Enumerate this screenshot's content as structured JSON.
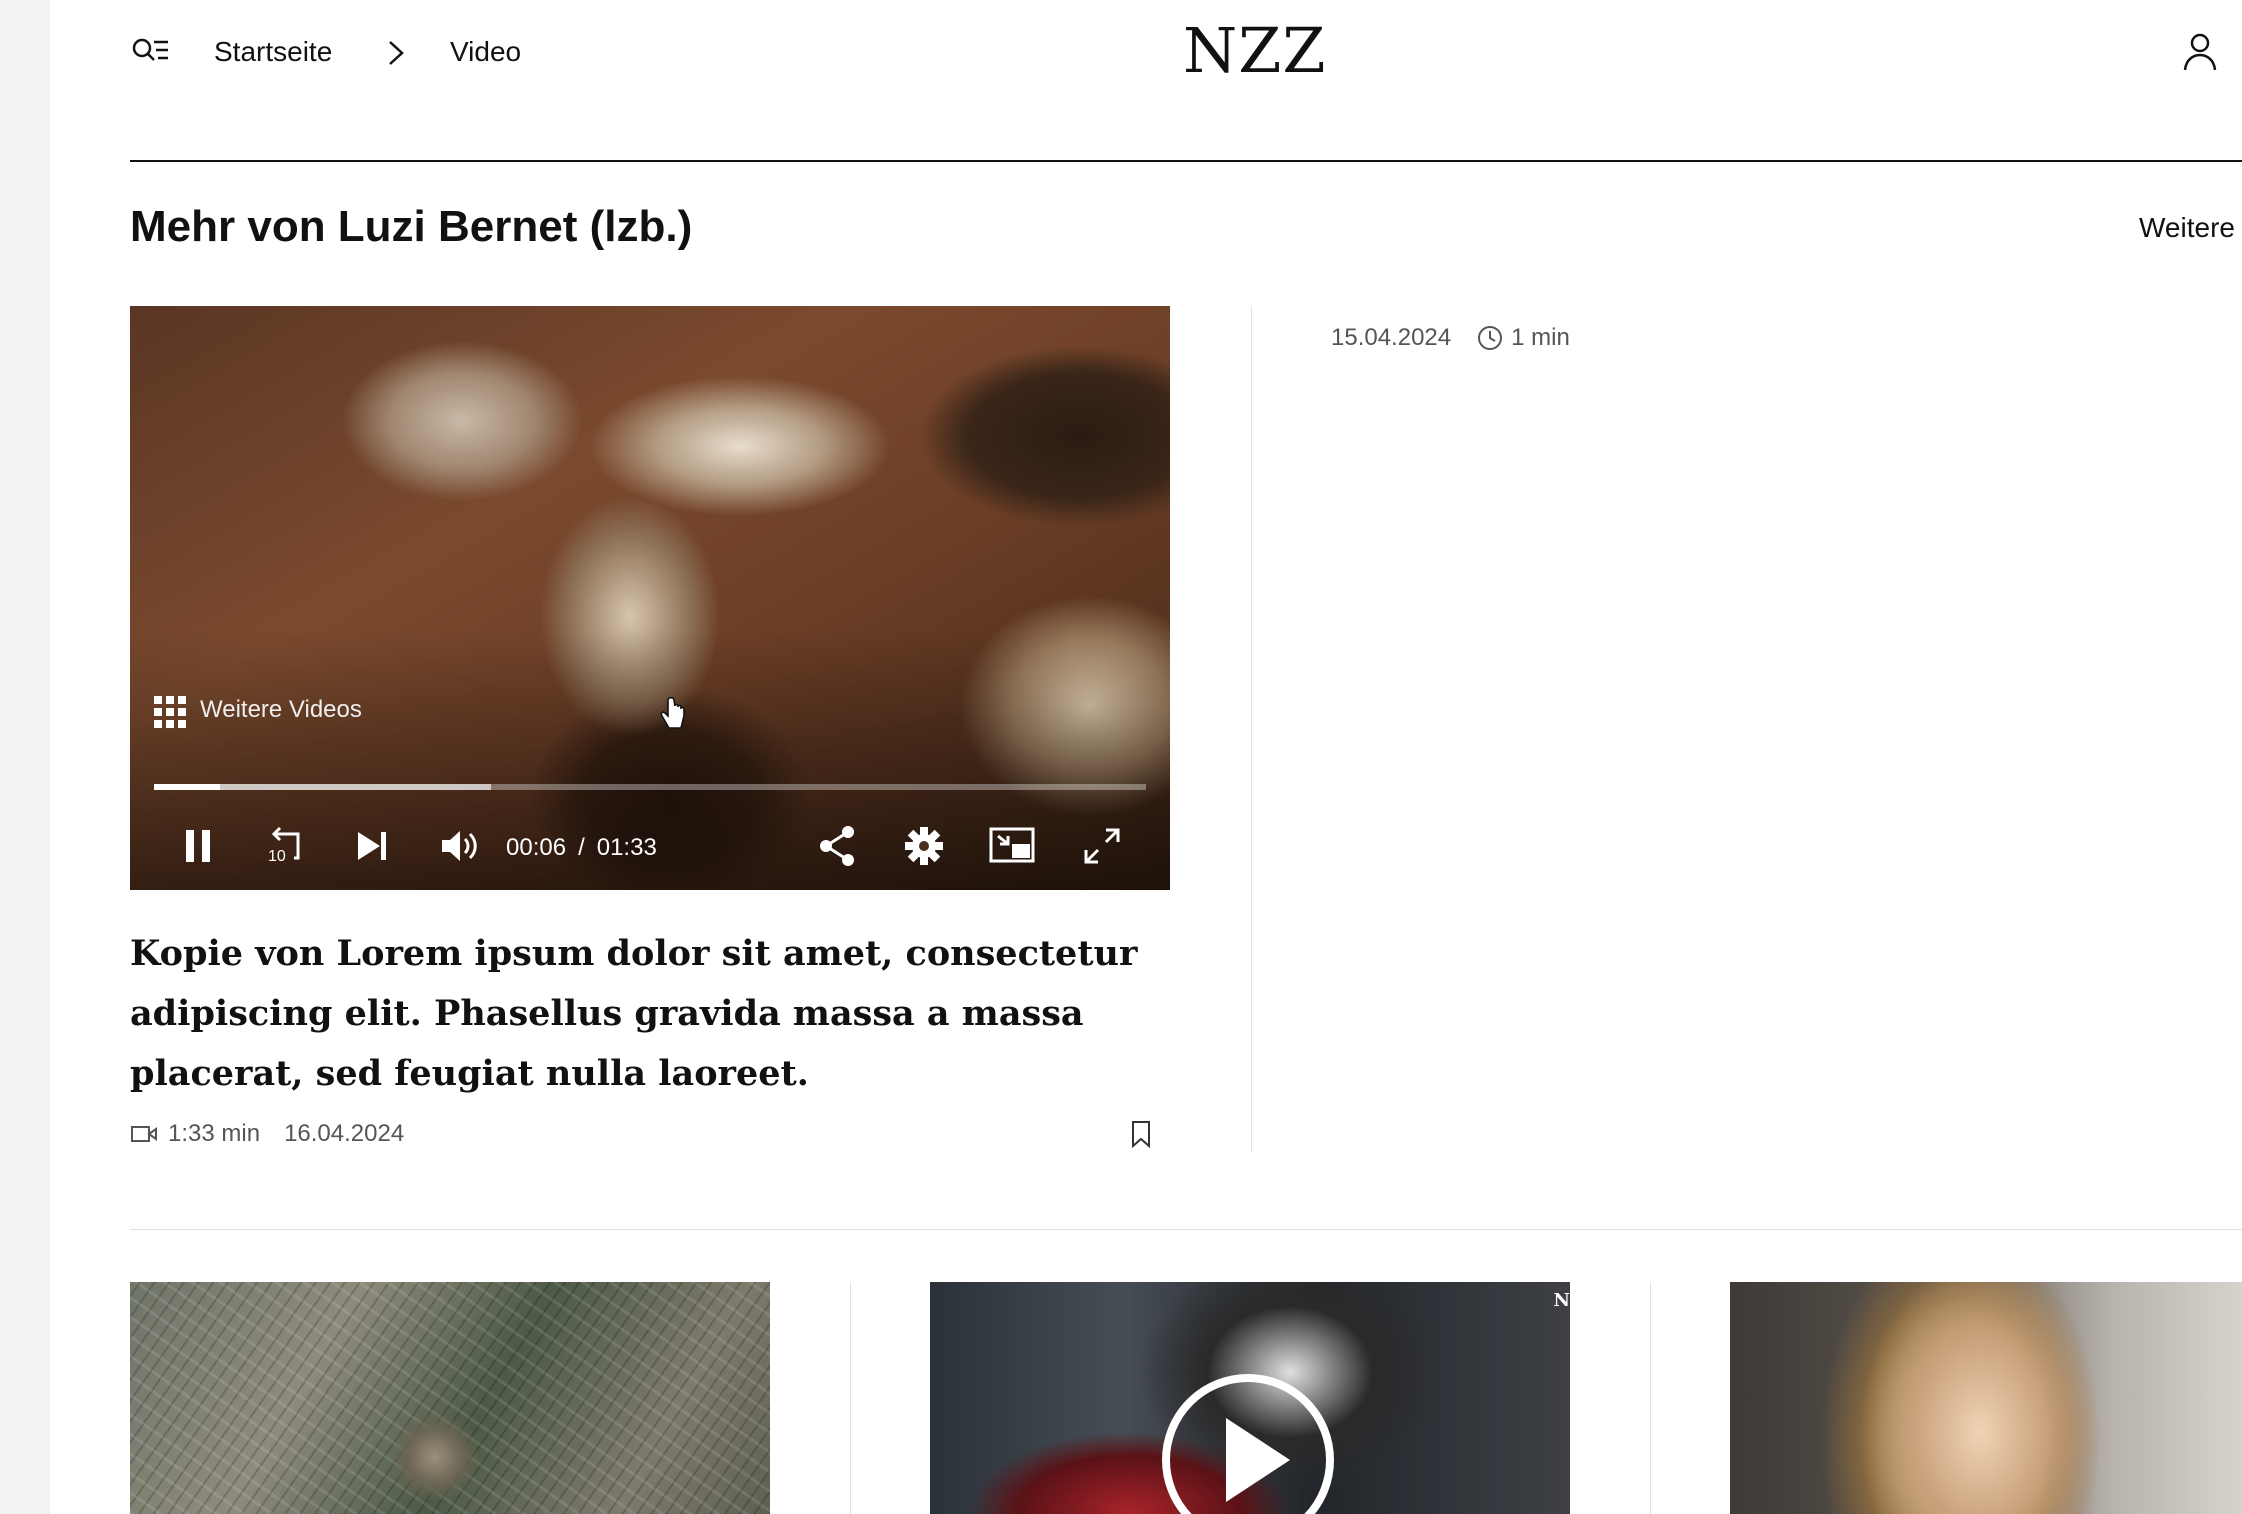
{
  "header": {
    "breadcrumb": [
      "Startseite",
      "Video"
    ],
    "logo": "NZZ"
  },
  "section": {
    "title": "Mehr von Luzi Bernet (lzb.)",
    "more_link": "Weitere"
  },
  "player": {
    "more_videos": "Weitere Videos",
    "current_time": "00:06",
    "time_separator": "/",
    "duration": "01:33",
    "played_fraction": 0.067,
    "buffered_fraction": 0.34,
    "skip_back_seconds": "10"
  },
  "video_card": {
    "title": "Kopie von Lorem ipsum dolor sit amet, consectetur adipiscing elit. Phasellus gravida massa a massa placerat, sed feugiat nulla laoreet.",
    "duration": "1:33 min",
    "date": "16.04.2024"
  },
  "side_item": {
    "date": "15.04.2024",
    "read_time": "1 min"
  },
  "cards": {
    "badge_text": "N"
  },
  "icons": {
    "menu": "search-menu-icon",
    "chevron": "chevron-right-icon",
    "user": "user-icon",
    "grid": "grid-icon",
    "pause": "pause-icon",
    "replay": "replay-10-icon",
    "next": "skip-next-icon",
    "volume": "volume-icon",
    "share": "share-icon",
    "settings": "gear-icon",
    "pip": "picture-in-picture-icon",
    "fullscreen": "fullscreen-icon",
    "video_meta": "video-camera-icon",
    "clock": "clock-icon",
    "bookmark": "bookmark-icon",
    "play": "play-icon"
  },
  "colors": {
    "text": "#111111",
    "muted": "#555555",
    "divider": "#e3e3e3"
  }
}
